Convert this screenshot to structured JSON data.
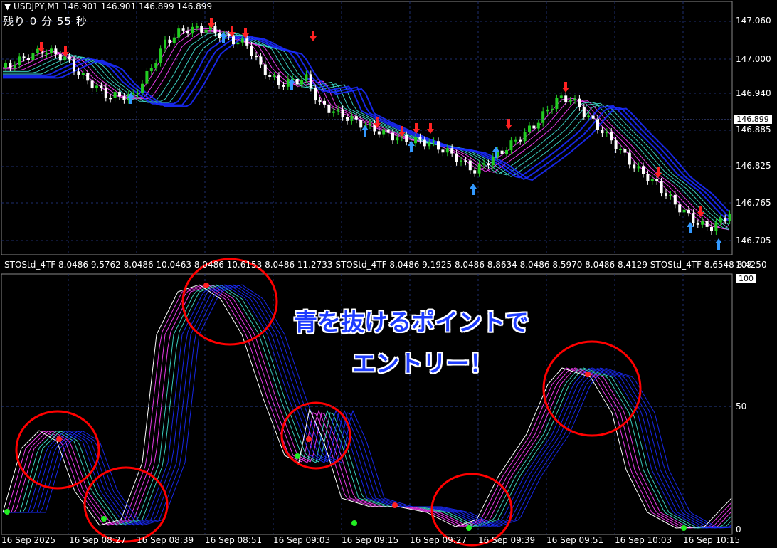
{
  "chart": {
    "symbol_header": "▼ USDJPY,M1  146.901 146.901 146.899 146.899",
    "timer": "残り 0 分 55 秒",
    "current_price": "146.899",
    "price_labels": [
      "147.060",
      "147.000",
      "146.940",
      "146.885",
      "146.825",
      "146.765",
      "146.705"
    ],
    "colors": {
      "bull": "#22cc22",
      "bear": "#ffffff",
      "ribbon_blue": "#1a2bff",
      "ribbon_magenta": "#ff40ff",
      "ribbon_cyan": "#40e0d0",
      "arrow_up": "#3399ff",
      "arrow_down": "#ff2222",
      "circle": "#ff0000",
      "grid": "#1e2e6e"
    }
  },
  "indicator": {
    "header": "STOStd_4TF 8.0486 9.5762 8.0486 10.0463 8.0486 10.6153 8.0486 11.2733   STOStd_4TF 8.0486 9.1925 8.0486 8.8634 8.0486 8.5970 8.0486 8.4129   STOStd_4TF 8.6548 8.4250",
    "scale_labels": [
      "108",
      "100",
      "50",
      "0"
    ]
  },
  "time_labels": [
    "16 Sep 2025",
    "16 Sep 08:27",
    "16 Sep 08:39",
    "16 Sep 08:51",
    "16 Sep 09:03",
    "16 Sep 09:15",
    "16 Sep 09:27",
    "16 Sep 09:39",
    "16 Sep 09:51",
    "16 Sep 10:03",
    "16 Sep 10:15"
  ],
  "callout": {
    "line1": "青を抜けるポイントで",
    "line2": "エントリー！"
  }
}
